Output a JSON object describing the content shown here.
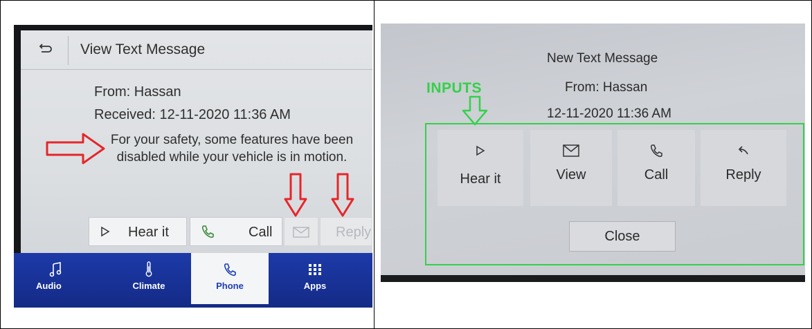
{
  "left_screen": {
    "header_title": "View Text Message",
    "from": "From: Hassan",
    "received": "Received: 12-11-2020 11:36 AM",
    "safety_line1": "For your safety, some features have been",
    "safety_line2": "disabled while your vehicle is in motion.",
    "buttons": {
      "hear_it": "Hear it",
      "call": "Call",
      "reply": "Reply"
    },
    "nav": {
      "audio": "Audio",
      "climate": "Climate",
      "phone": "Phone",
      "apps": "Apps"
    }
  },
  "right_screen": {
    "title": "New Text Message",
    "from": "From: Hassan",
    "date": "12-11-2020 11:36 AM",
    "annotation_label": "INPUTS",
    "buttons": {
      "hear_it": "Hear it",
      "view": "View",
      "call": "Call",
      "reply": "Reply",
      "close": "Close"
    }
  },
  "colors": {
    "annotation_red": "#e5262a",
    "annotation_green": "#35d04a",
    "nav_blue": "#1c3aa8",
    "active_phone_text": "#1d3eb5"
  },
  "icons": [
    "back-icon",
    "play-icon",
    "phone-icon",
    "envelope-icon",
    "reply-icon",
    "music-note-icon",
    "thermometer-icon",
    "apps-grid-icon"
  ]
}
